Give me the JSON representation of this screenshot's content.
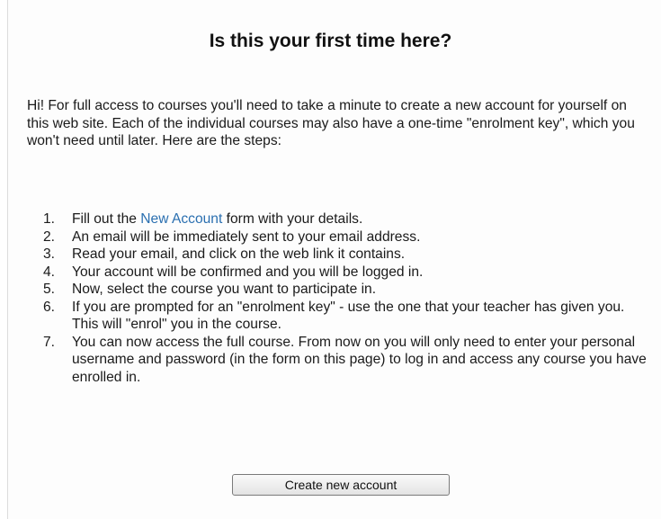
{
  "heading": "Is this your first time here?",
  "intro": "Hi! For full access to courses you'll need to take a minute to create a new account for yourself on this web site. Each of the individual courses may also have a one-time \"enrolment key\", which you won't need until later. Here are the steps:",
  "steps": [
    {
      "num": "1.",
      "before": "Fill out the ",
      "link": "New Account",
      "after": " form with your details."
    },
    {
      "num": "2.",
      "text": "An email will be immediately sent to your email address."
    },
    {
      "num": "3.",
      "text": "Read your email, and click on the web link it contains."
    },
    {
      "num": "4.",
      "text": "Your account will be confirmed and you will be logged in."
    },
    {
      "num": "5.",
      "text": "Now, select the course you want to participate in."
    },
    {
      "num": "6.",
      "text": "If you are prompted for an \"enrolment key\" - use the one that your teacher has given you. This will \"enrol\" you in the course."
    },
    {
      "num": "7.",
      "text": "You can now access the full course. From now on you will only need to enter your personal username and password (in the form on this page) to log in and access any course you have enrolled in."
    }
  ],
  "button_label": "Create new account",
  "colors": {
    "link": "#2a6fb0",
    "text": "#1a1a1a"
  }
}
